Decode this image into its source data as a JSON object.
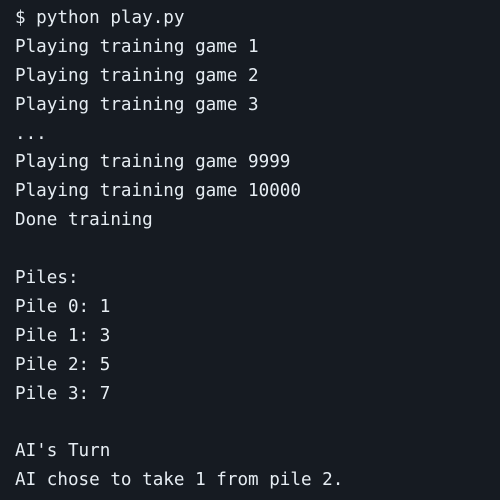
{
  "terminal": {
    "lines": [
      "$ python play.py",
      "Playing training game 1",
      "Playing training game 2",
      "Playing training game 3",
      "...",
      "Playing training game 9999",
      "Playing training game 10000",
      "Done training",
      "",
      "Piles:",
      "Pile 0: 1",
      "Pile 1: 3",
      "Pile 2: 5",
      "Pile 3: 7",
      "",
      "AI's Turn",
      "AI chose to take 1 from pile 2."
    ]
  },
  "colors": {
    "background": "#161b22",
    "text": "#e6edf3"
  }
}
